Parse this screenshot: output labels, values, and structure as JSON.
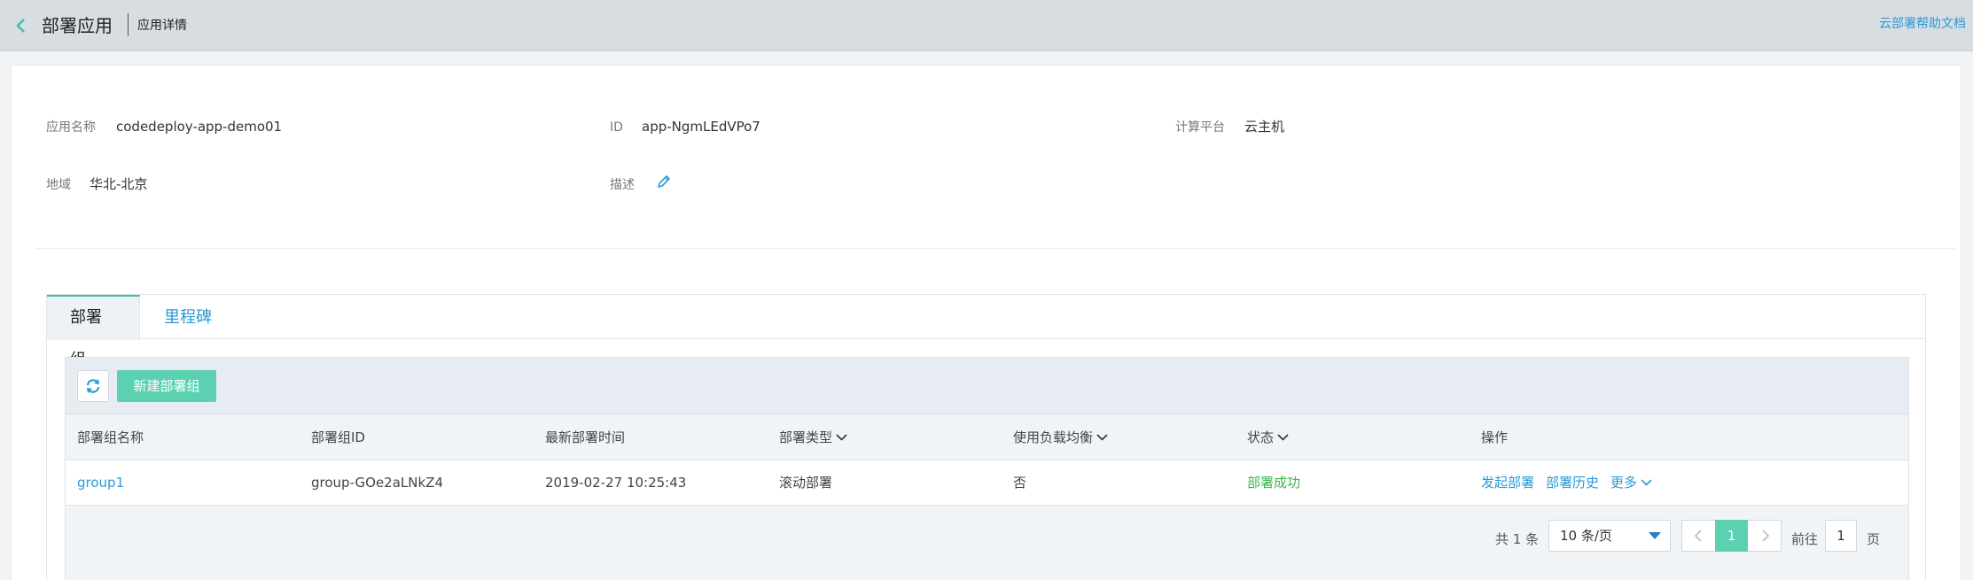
{
  "header": {
    "title": "部署应用",
    "subtitle": "应用详情",
    "help_link": "云部署帮助文档"
  },
  "info": {
    "app_name_label": "应用名称",
    "app_name_value": "codedeploy-app-demo01",
    "id_label": "ID",
    "id_value": "app-NgmLEdVPo7",
    "platform_label": "计算平台",
    "platform_value": "云主机",
    "region_label": "地域",
    "region_value": "华北-北京",
    "desc_label": "描述"
  },
  "tabs": [
    {
      "label": "部署组",
      "active": true
    },
    {
      "label": "里程碑",
      "active": false
    }
  ],
  "toolbar": {
    "new_button": "新建部署组"
  },
  "table": {
    "columns": [
      "部署组名称",
      "部署组ID",
      "最新部署时间",
      "部署类型",
      "使用负载均衡",
      "状态",
      "操作"
    ],
    "rows": [
      {
        "name": "group1",
        "id": "group-GOe2aLNkZ4",
        "time": "2019-02-27 10:25:43",
        "type": "滚动部署",
        "lb": "否",
        "status": "部署成功",
        "actions": [
          "发起部署",
          "部署历史",
          "更多"
        ]
      }
    ]
  },
  "pagination": {
    "total": "共 1 条",
    "page_size": "10 条/页",
    "current_page": "1",
    "goto_label": "前往",
    "goto_value": "1",
    "page_unit": "页"
  },
  "colors": {
    "accent_teal": "#5bd1b1",
    "link_blue": "#2a9bd8",
    "success_green": "#3bb54a"
  }
}
